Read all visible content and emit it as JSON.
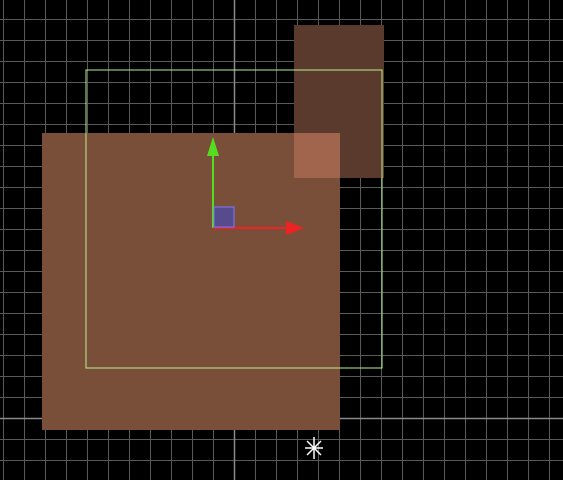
{
  "editor": {
    "tool": "move",
    "grid": {
      "visible": true
    }
  },
  "colors": {
    "background": "#000000",
    "grid_line": "#5a5a5a",
    "grid_major_line": "#8a8a8a",
    "sprite_primary": "#7a4f3a",
    "sprite_secondary": "#5a3a2c",
    "sprite_overlap": "#a0654c",
    "selection_outline": "#b8f08a",
    "gizmo_y_axis": "#55dd22",
    "gizmo_x_axis": "#ee2222",
    "gizmo_center": "#4a4aaa",
    "cursor": "#ffffff"
  },
  "icons": {
    "gizmo_y": "arrow-up-icon",
    "gizmo_x": "arrow-right-icon",
    "gizmo_center": "square-handle-icon",
    "cursor": "sparkle-cursor-icon"
  }
}
